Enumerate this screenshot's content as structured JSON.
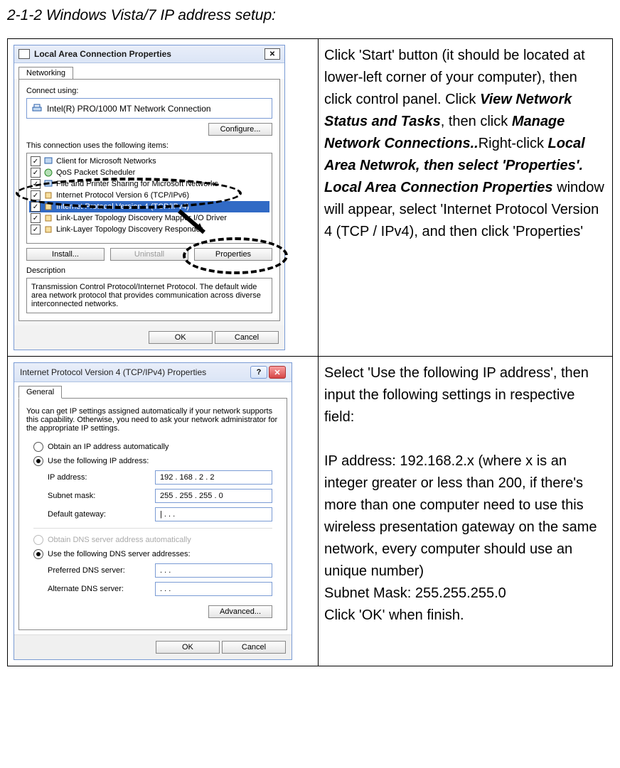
{
  "page": {
    "title": "2-1-2 Windows Vista/7 IP address setup:"
  },
  "row1": {
    "instruction_parts": {
      "p1": "Click 'Start' button (it should be located at lower-left corner of your computer), then click control panel. Click ",
      "b1": "View Network Status and Tasks",
      "p2": ", then click ",
      "b2": "Manage Network Connections..",
      "p3": "Right-click ",
      "b3": "Local Area Netwrok, then select 'Properties'. Local Area Connection Properties",
      "p4": " window will appear, select 'Internet Protocol Version 4 (TCP / IPv4), and then click 'Properties'"
    },
    "dialog": {
      "title": "Local Area Connection Properties",
      "tab": "Networking",
      "connect_using_label": "Connect using:",
      "adapter": "Intel(R) PRO/1000 MT Network Connection",
      "configure_btn": "Configure...",
      "items_label": "This connection uses the following items:",
      "items": [
        "Client for Microsoft Networks",
        "QoS Packet Scheduler",
        "File and Printer Sharing for Microsoft Networks",
        "Internet Protocol Version 6 (TCP/IPv6)",
        "Internet Protocol Version 4 (TCP/IPv4)",
        "Link-Layer Topology Discovery Mapper I/O Driver",
        "Link-Layer Topology Discovery Responder"
      ],
      "install_btn": "Install...",
      "uninstall_btn": "Uninstall",
      "properties_btn": "Properties",
      "desc_label": "Description",
      "desc_text": "Transmission Control Protocol/Internet Protocol. The default wide area network protocol that provides communication across diverse interconnected networks.",
      "ok_btn": "OK",
      "cancel_btn": "Cancel"
    }
  },
  "row2": {
    "instruction_p1": "Select 'Use the following IP address', then input the following settings in respective field:",
    "instruction_p2": "IP address: 192.168.2.x (where x is an integer greater or less than 200, if there's more than one computer need to use this wireless presentation gateway on the same network, every computer should use an unique number)",
    "instruction_p3": "Subnet Mask: 255.255.255.0",
    "instruction_p4": "Click 'OK' when finish.",
    "dialog": {
      "title": "Internet Protocol Version 4 (TCP/IPv4) Properties",
      "tab": "General",
      "intro": "You can get IP settings assigned automatically if your network supports this capability. Otherwise, you need to ask your network administrator for the appropriate IP settings.",
      "radio_auto_ip": "Obtain an IP address automatically",
      "radio_use_ip": "Use the following IP address:",
      "ip_label": "IP address:",
      "ip_value": "192 . 168  .   2   .   2",
      "mask_label": "Subnet mask:",
      "mask_value": "255 . 255 . 255 .   0",
      "gw_label": "Default gateway:",
      "gw_value": "|    .        .        .",
      "radio_auto_dns": "Obtain DNS server address automatically",
      "radio_use_dns": "Use the following DNS server addresses:",
      "pdns_label": "Preferred DNS server:",
      "pdns_value": ".        .        .",
      "adns_label": "Alternate DNS server:",
      "adns_value": ".        .        .",
      "adv_btn": "Advanced...",
      "ok_btn": "OK",
      "cancel_btn": "Cancel"
    }
  }
}
